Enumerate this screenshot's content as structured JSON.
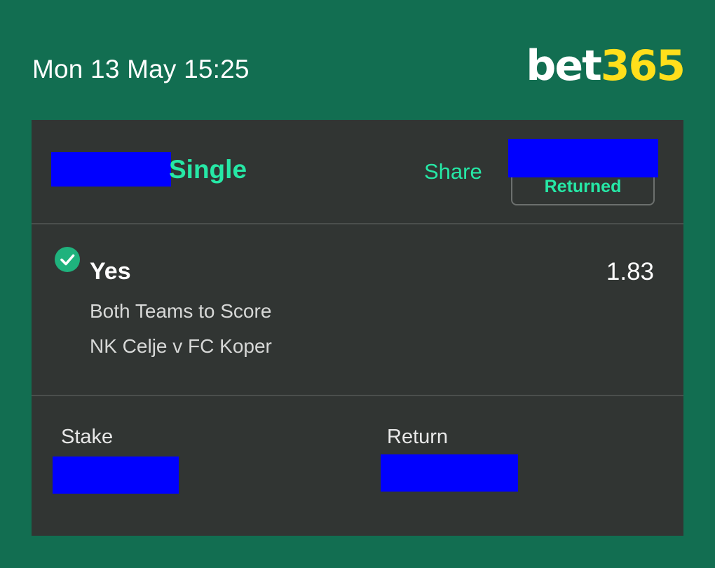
{
  "header": {
    "datetime": "Mon 13 May 15:25",
    "logo_part1": "bet",
    "logo_part2": "365"
  },
  "bet": {
    "type": "Single",
    "share_label": "Share",
    "status": "Returned",
    "selection": {
      "name": "Yes",
      "odds": "1.83",
      "market": "Both Teams to Score",
      "event": "NK Celje v FC Koper",
      "icon": "check-circle-icon"
    },
    "stake_label": "Stake",
    "return_label": "Return"
  },
  "colors": {
    "background": "#126e51",
    "card": "#313533",
    "accent": "#26e8a6",
    "logo_yellow": "#ffdf1b",
    "redaction": "#0000ff"
  }
}
